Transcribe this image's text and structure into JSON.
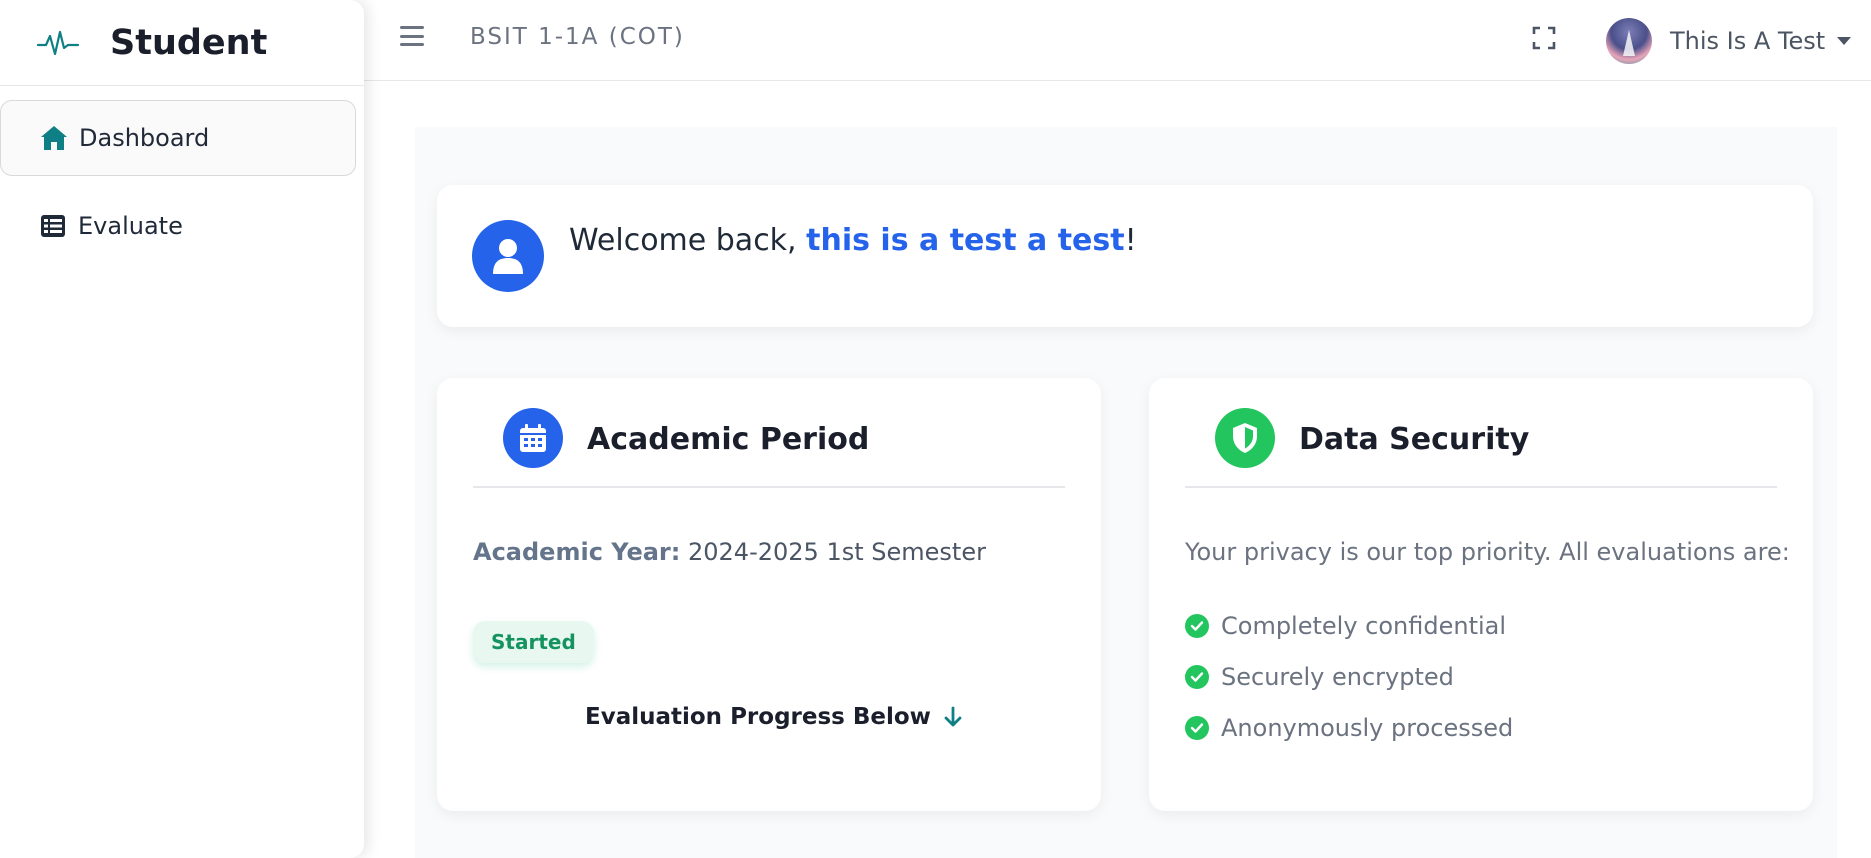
{
  "sidebar": {
    "brand": {
      "icon": "pulse-icon",
      "title": "Student"
    },
    "items": [
      {
        "label": "Dashboard",
        "icon": "home-icon",
        "active": true
      },
      {
        "label": "Evaluate",
        "icon": "list-icon",
        "active": false
      }
    ]
  },
  "header": {
    "menu_icon": "hamburger-icon",
    "course": "BSIT 1-1A (COT)",
    "fullscreen_icon": "fullscreen-icon",
    "user_name": "This Is A Test"
  },
  "welcome": {
    "prefix": "Welcome back, ",
    "name": "this is a test a test",
    "suffix": "!"
  },
  "academic": {
    "title": "Academic Period",
    "year_label": "Academic Year:",
    "year_value": "2024-2025 1st Semester",
    "status": "Started",
    "progress_text": "Evaluation Progress Below"
  },
  "security": {
    "title": "Data Security",
    "intro": "Your privacy is our top priority. All evaluations are:",
    "points": [
      "Completely confidential",
      "Securely encrypted",
      "Anonymously processed"
    ]
  },
  "colors": {
    "primary": "#2563eb",
    "success": "#22c55e",
    "brand_teal": "#0f7f86"
  }
}
